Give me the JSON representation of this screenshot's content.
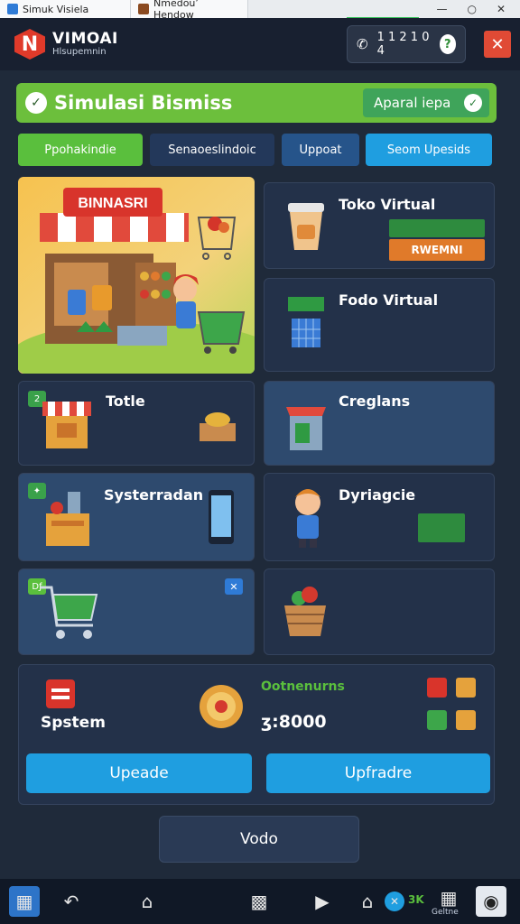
{
  "browser": {
    "tabs": [
      {
        "title": "Simuk Visiela"
      },
      {
        "title": "Nmedou’ Hendow"
      }
    ],
    "controls": [
      "—",
      "○",
      "✕"
    ]
  },
  "header": {
    "brand_name": "VIMOAI",
    "brand_sub": "Hlsupemnin",
    "balance": "1 1 2 1 0 4",
    "balance_icon": "phone-icon"
  },
  "main": {
    "title": "Simulasi Bismiss",
    "title_action": "Aparal iepa",
    "tabs": [
      {
        "label": "Ppohakindie"
      },
      {
        "label": "Senaoeslindoic"
      },
      {
        "label": "Uppoat"
      },
      {
        "label": "Seom Upesids"
      }
    ],
    "hero": {
      "sign_text": "BINNASRI"
    },
    "cards": {
      "toko_virtual": {
        "label": "Toko Virtual",
        "button": "RWEMNI"
      },
      "fodo_virtual": {
        "label": "Fodo Virtual"
      },
      "totle": {
        "label": "Totle",
        "badge": "2"
      },
      "creglans": {
        "label": "Creglans"
      },
      "systerradan": {
        "label": "Systerradan",
        "badge": "✦"
      },
      "dyriagcie": {
        "label": "Dyriagcie"
      },
      "cart": {
        "badge": "Dƒ",
        "close": "✕"
      }
    },
    "summary": {
      "system_label": "Spstem",
      "stats_title": "Ootnenurns",
      "stats_value": "ʒ:8000",
      "btn_left": "Upeade",
      "btn_right": "Upfradre"
    },
    "footer_button": "Vodo"
  },
  "taskbar": {
    "label": "Geltne",
    "extra_text": "3K"
  },
  "colors": {
    "background": "#1f2a3a",
    "green": "#6cbf3c",
    "blue": "#1f9ee0",
    "red": "#e04a35",
    "card": "#233149"
  }
}
